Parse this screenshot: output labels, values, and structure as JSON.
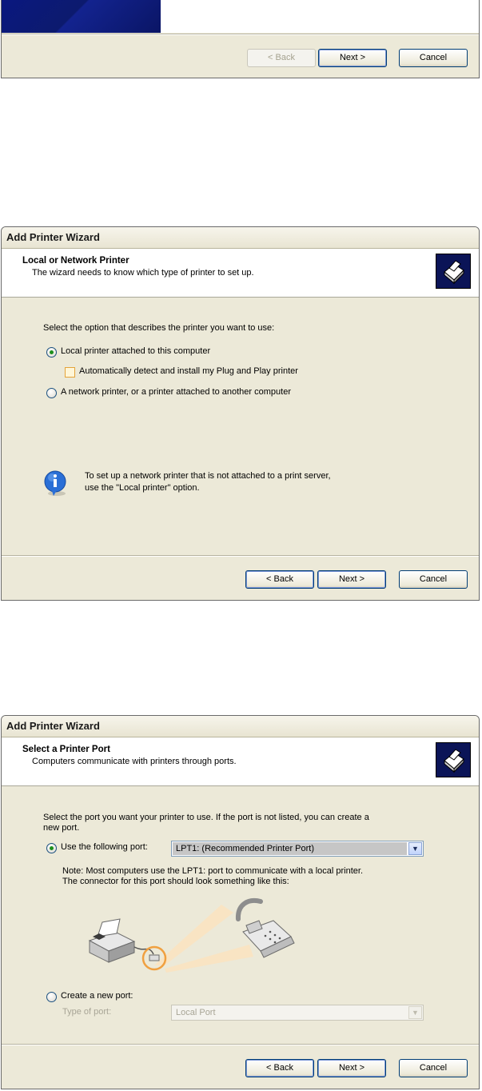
{
  "dialog1": {
    "buttons": {
      "back": "< Back",
      "next": "Next >",
      "cancel": "Cancel"
    }
  },
  "dialog2": {
    "window_title": "Add Printer Wizard",
    "header_title": "Local or Network Printer",
    "header_subtitle": "The wizard needs to know which type of printer to set up.",
    "prompt": "Select the option that describes the printer you want to use:",
    "option_local": "Local printer attached to this computer",
    "option_local_selected": true,
    "auto_detect": "Automatically detect and install my Plug and Play printer",
    "auto_detect_checked": false,
    "option_network": "A network printer, or a printer attached to another computer",
    "info_line1": "To set up a network printer that is not attached to a print server,",
    "info_line2": "use the \"Local printer\" option.",
    "buttons": {
      "back": "< Back",
      "next": "Next >",
      "cancel": "Cancel"
    }
  },
  "dialog3": {
    "window_title": "Add Printer Wizard",
    "header_title": "Select a Printer Port",
    "header_subtitle": "Computers communicate with printers through ports.",
    "prompt_line1": "Select the port you want your printer to use.  If the port is not listed, you can create a",
    "prompt_line2": "new port.",
    "use_port_label": "Use the following port:",
    "use_port_selected": true,
    "port_value": "LPT1: (Recommended Printer Port)",
    "note_line1": "Note: Most computers use the LPT1: port to communicate with a local printer.",
    "note_line2": "The connector for this port should look something like this:",
    "create_port_label": "Create a new port:",
    "type_of_port_label": "Type of port:",
    "type_of_port_value": "Local Port",
    "buttons": {
      "back": "< Back",
      "next": "Next >",
      "cancel": "Cancel"
    }
  },
  "colors": {
    "dialog_bg": "#ece9d8",
    "header_icon_bg": "#0b1457",
    "radio_dot": "#1d8f1d",
    "highlight_orange": "#f0a040"
  }
}
